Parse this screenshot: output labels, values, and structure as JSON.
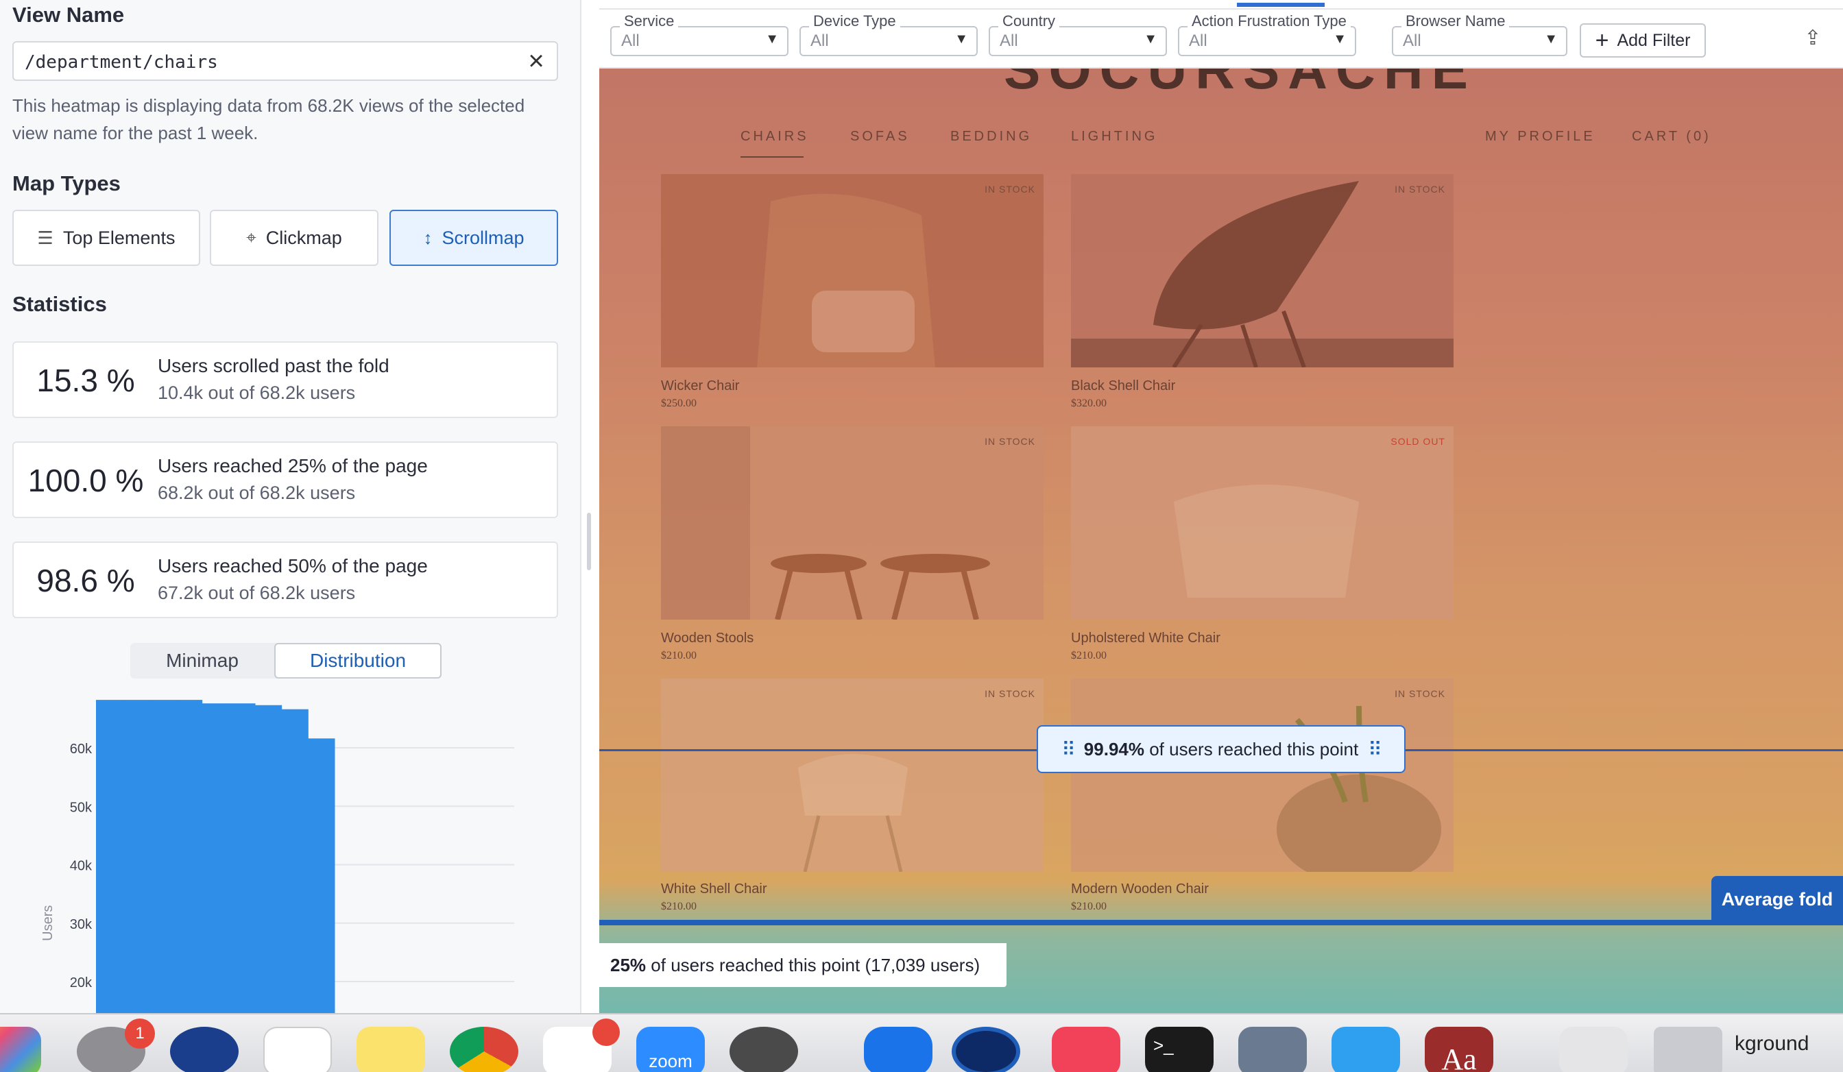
{
  "left_panel": {
    "view_name_title": "View Name",
    "view_name_value": "/department/chairs",
    "description": "This heatmap is displaying data from 68.2K views of the selected view name for the past 1 week.",
    "map_types_title": "Map Types",
    "map_types": [
      {
        "label": "Top Elements",
        "icon": "list-icon",
        "active": false
      },
      {
        "label": "Clickmap",
        "icon": "cursor-click-icon",
        "active": false
      },
      {
        "label": "Scrollmap",
        "icon": "vertical-arrows-icon",
        "active": true
      }
    ],
    "statistics_title": "Statistics",
    "stats": [
      {
        "percent": "15.3 %",
        "label": "Users scrolled past the fold",
        "sub": "10.4k out of 68.2k users"
      },
      {
        "percent": "100.0 %",
        "label": "Users reached 25% of the page",
        "sub": "68.2k out of 68.2k users"
      },
      {
        "percent": "98.6 %",
        "label": "Users reached 50% of the page",
        "sub": "67.2k out of 68.2k users"
      }
    ],
    "view_tabs": [
      {
        "label": "Minimap",
        "active": false
      },
      {
        "label": "Distribution",
        "active": true
      }
    ]
  },
  "chart_data": {
    "type": "bar",
    "ylabel": "Users",
    "yticks": [
      "20k",
      "30k",
      "40k",
      "50k",
      "60k"
    ],
    "values": [
      68200,
      68200,
      68200,
      68200,
      67600,
      67600,
      67300,
      66600,
      61600
    ],
    "visible_ymin": 17000,
    "visible_ymax": 70000,
    "color": "#2f8ee8"
  },
  "filters": [
    {
      "label": "Service",
      "value": "All"
    },
    {
      "label": "Device Type",
      "value": "All"
    },
    {
      "label": "Country",
      "value": "All"
    },
    {
      "label": "Action Frustration Type",
      "value": "All"
    },
    {
      "label": "Browser Name",
      "value": "All"
    }
  ],
  "add_filter_label": "Add Filter",
  "site": {
    "nav_left": [
      "CHAIRS",
      "SOFAS",
      "BEDDING",
      "LIGHTING"
    ],
    "nav_right": [
      "MY PROFILE",
      "CART (0)"
    ],
    "products": [
      {
        "name": "Wicker Chair",
        "price": "$250.00",
        "stock": "IN STOCK"
      },
      {
        "name": "Black Shell Chair",
        "price": "$320.00",
        "stock": "IN STOCK"
      },
      {
        "name": "Wooden Stools",
        "price": "$210.00",
        "stock": "IN STOCK"
      },
      {
        "name": "Upholstered White Chair",
        "price": "$210.00",
        "stock": "SOLD OUT"
      },
      {
        "name": "White Shell Chair",
        "price": "$210.00",
        "stock": "IN STOCK"
      },
      {
        "name": "Modern Wooden Chair",
        "price": "$210.00",
        "stock": "IN STOCK"
      }
    ]
  },
  "markers": {
    "point_percent": "99.94%",
    "point_text": "of users reached this point",
    "average_fold": "Average fold",
    "quarter_percent": "25%",
    "quarter_text": "of users reached this point (17,039 users)"
  },
  "dock": {
    "settings_badge": "1",
    "zoom_label": "zoom",
    "trailing_text": "kground"
  },
  "colors": {
    "accent": "#2f6fd1",
    "fold": "#1f5fba",
    "bar": "#2f8ee8"
  }
}
